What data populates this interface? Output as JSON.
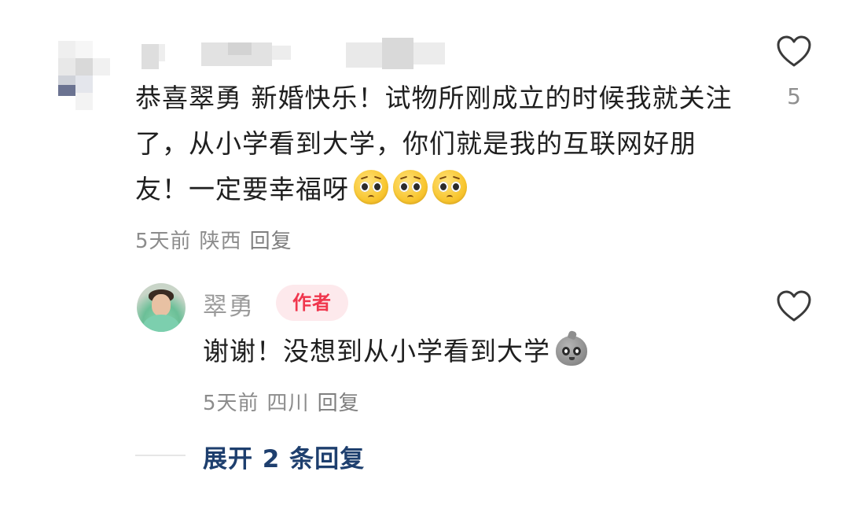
{
  "comment": {
    "text": "恭喜翠勇 新婚快乐！试物所刚成立的时候我就关注了，从小学看到大学，你们就是我的互联网好朋友！一定要幸福呀",
    "emoji_icon": "pleading-face-emoji",
    "emoji_count": 3,
    "time": "5天前",
    "location": "陕西",
    "reply_label": "回复",
    "likes": "5"
  },
  "reply": {
    "author": "翠勇",
    "badge": "作者",
    "text": "谢谢！没想到从小学看到大学",
    "emoji_icon": "doge-sack-emoji",
    "time": "5天前",
    "location": "四川",
    "reply_label": "回复"
  },
  "expand": {
    "label": "展开 2 条回复"
  },
  "colors": {
    "badge_bg": "#fde9ec",
    "badge_text": "#f0364d",
    "expand_text": "#1e3f6e",
    "meta_text": "#8c8c8c"
  }
}
